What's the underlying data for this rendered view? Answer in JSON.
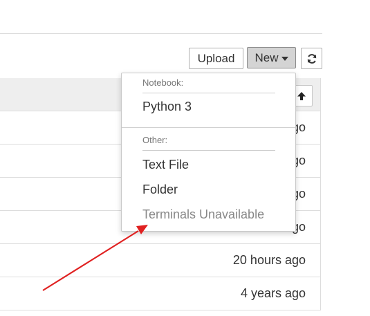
{
  "toolbar": {
    "upload_label": "Upload",
    "new_label": "New",
    "refresh_icon": "refresh-icon"
  },
  "table": {
    "sort_icon": "arrow-up-icon",
    "rows": [
      {
        "modified": "ago"
      },
      {
        "modified": "ago"
      },
      {
        "modified": "ago"
      },
      {
        "modified": "ago"
      },
      {
        "modified": "20 hours ago"
      },
      {
        "modified": "4 years ago"
      }
    ]
  },
  "new_menu": {
    "notebook_header": "Notebook:",
    "notebook_items": [
      "Python 3"
    ],
    "other_header": "Other:",
    "other_items": [
      {
        "label": "Text File",
        "enabled": true
      },
      {
        "label": "Folder",
        "enabled": true
      },
      {
        "label": "Terminals Unavailable",
        "enabled": false
      }
    ]
  },
  "annotation": {
    "arrow_color": "#e02020"
  }
}
